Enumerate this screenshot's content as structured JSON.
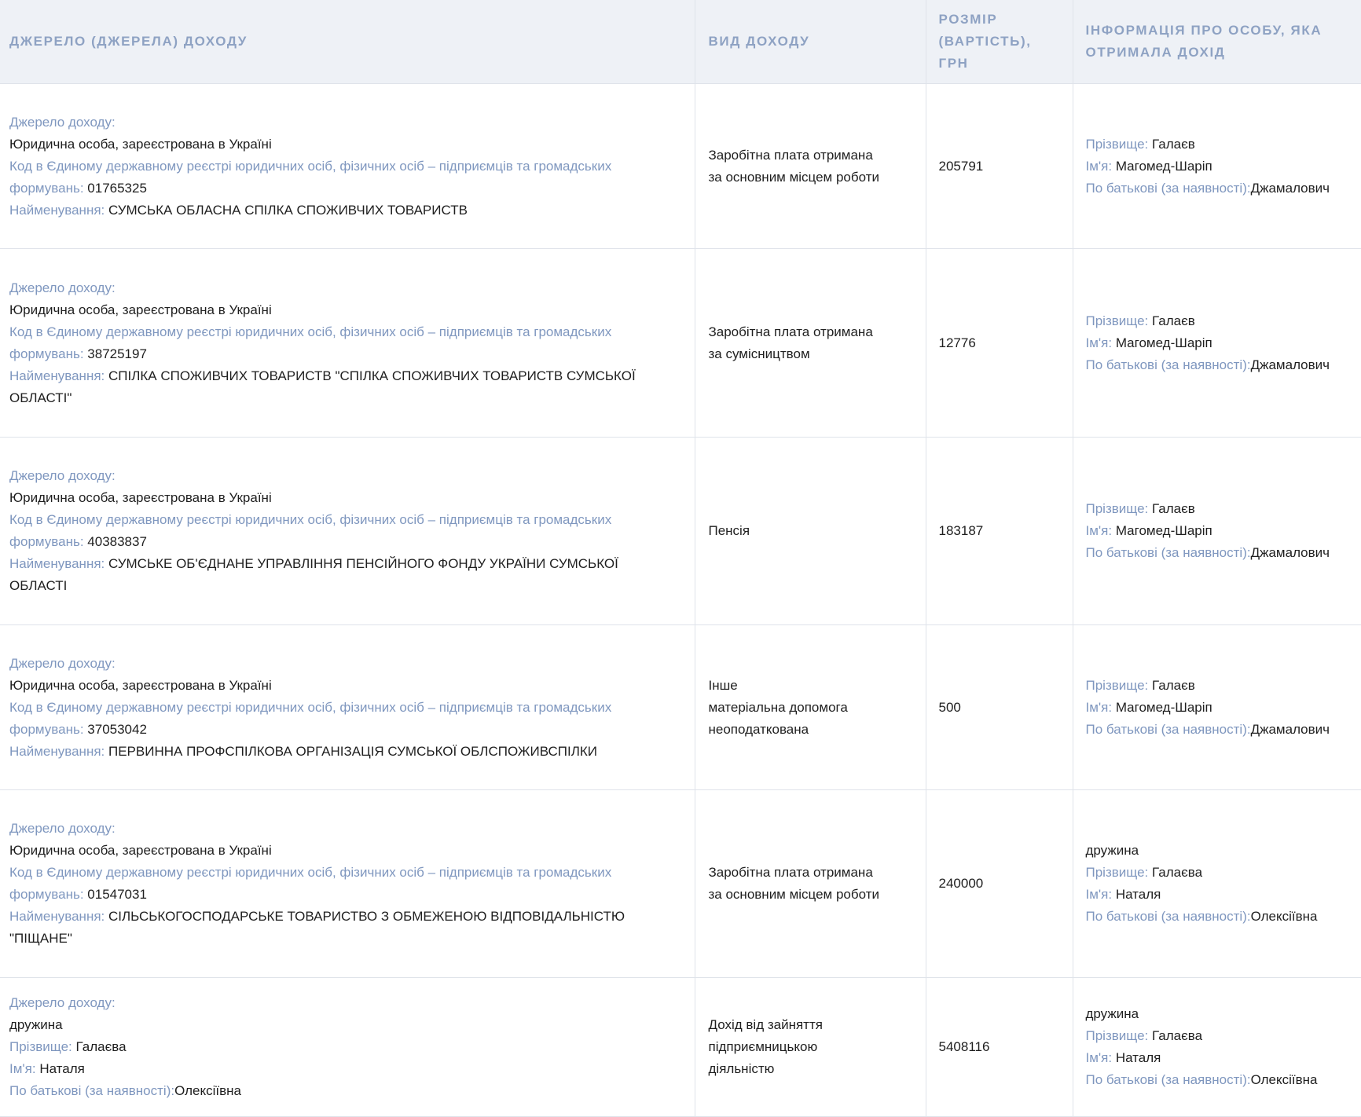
{
  "header": {
    "col_source": "ДЖЕРЕЛО (ДЖЕРЕЛА) ДОХОДУ",
    "col_type": "ВИД ДОХОДУ",
    "col_amount_1": "РОЗМІР",
    "col_amount_2": "(ВАРТІСТЬ),",
    "col_amount_3": "ГРН",
    "col_person": "ІНФОРМАЦІЯ ПРО ОСОБУ, ЯКА ОТРИМАЛА ДОХІД"
  },
  "labels": {
    "source": "Джерело доходу:",
    "code_1": "Код в Єдиному державному реєстрі юридичних осіб, фізичних осіб – підприємців та громадських",
    "code_2": "формувань:",
    "name": "Найменування:",
    "surname": "Прізвище:",
    "first_name": "Ім'я:",
    "patronymic": "По батькові (за наявності):"
  },
  "rows": [
    {
      "source_type": "Юридична особа, зареєстрована в Україні",
      "code": "01765325",
      "name": "СУМСЬКА ОБЛАСНА СПІЛКА СПОЖИВЧИХ ТОВАРИСТВ",
      "income_type": [
        "Заробітна плата отримана",
        "за основним місцем роботи"
      ],
      "amount": "205791",
      "person": {
        "relation": "",
        "surname": "Галаєв",
        "first_name": "Магомед-Шаріп",
        "patronymic": "Джамалович"
      }
    },
    {
      "source_type": "Юридична особа, зареєстрована в Україні",
      "code": "38725197",
      "name": "СПІЛКА СПОЖИВЧИХ ТОВАРИСТВ \"СПІЛКА СПОЖИВЧИХ ТОВАРИСТВ СУМСЬКОЇ ОБЛАСТІ\"",
      "income_type": [
        "Заробітна плата отримана",
        "за сумісництвом"
      ],
      "amount": "12776",
      "person": {
        "relation": "",
        "surname": "Галаєв",
        "first_name": "Магомед-Шаріп",
        "patronymic": "Джамалович"
      }
    },
    {
      "source_type": "Юридична особа, зареєстрована в Україні",
      "code": "40383837",
      "name": "СУМСЬКЕ ОБ'ЄДНАНЕ УПРАВЛІННЯ ПЕНСІЙНОГО ФОНДУ УКРАЇНИ СУМСЬКОЇ ОБЛАСТІ",
      "income_type": [
        "Пенсія"
      ],
      "amount": "183187",
      "person": {
        "relation": "",
        "surname": "Галаєв",
        "first_name": "Магомед-Шаріп",
        "patronymic": "Джамалович"
      }
    },
    {
      "source_type": "Юридична особа, зареєстрована в Україні",
      "code": "37053042",
      "name": "ПЕРВИННА ПРОФСПІЛКОВА ОРГАНІЗАЦІЯ СУМСЬКОЇ ОБЛСПОЖИВСПІЛКИ",
      "income_type": [
        "Інше",
        "матеріальна допомога",
        "неоподаткована"
      ],
      "amount": "500",
      "person": {
        "relation": "",
        "surname": "Галаєв",
        "first_name": "Магомед-Шаріп",
        "patronymic": "Джамалович"
      }
    },
    {
      "source_type": "Юридична особа, зареєстрована в Україні",
      "code": "01547031",
      "name": "СІЛЬСЬКОГОСПОДАРСЬКЕ ТОВАРИСТВО З ОБМЕЖЕНОЮ ВІДПОВІДАЛЬНІСТЮ \"ПІЩАНЕ\"",
      "income_type": [
        "Заробітна плата отримана",
        "за основним місцем роботи"
      ],
      "amount": "240000",
      "person": {
        "relation": "дружина",
        "surname": "Галаєва",
        "first_name": "Наталя",
        "patronymic": "Олексіївна"
      }
    },
    {
      "source_person": {
        "relation": "дружина",
        "surname": "Галаєва",
        "first_name": "Наталя",
        "patronymic": "Олексіївна"
      },
      "income_type": [
        "Дохід від зайняття",
        "підприємницькою",
        "діяльністю"
      ],
      "amount": "5408116",
      "person": {
        "relation": "дружина",
        "surname": "Галаєва",
        "first_name": "Наталя",
        "patronymic": "Олексіївна"
      }
    }
  ]
}
